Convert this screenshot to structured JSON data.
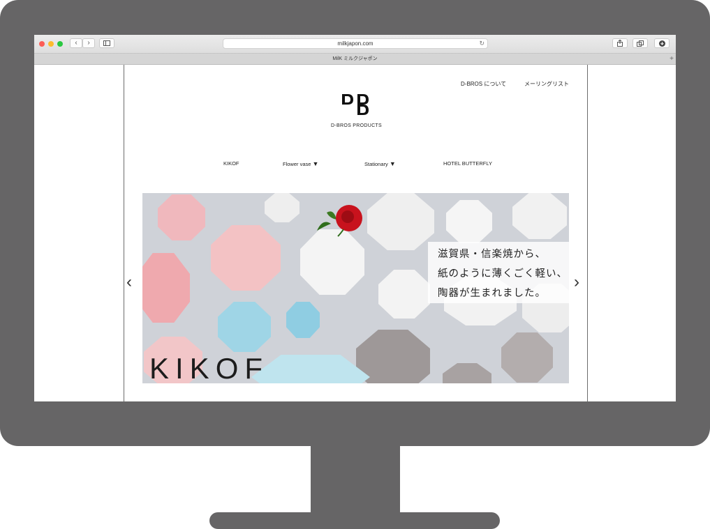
{
  "browser": {
    "url": "milkjapon.com",
    "tab_title": "MilK ミルクジャポン",
    "icons": [
      "chevron-left-icon",
      "chevron-right-icon",
      "sidebar-icon",
      "reload-icon",
      "share-icon",
      "tabs-icon",
      "download-icon",
      "plus-icon"
    ]
  },
  "site": {
    "top_links": {
      "about": "D-BROS について",
      "mailing": "メーリングリスト"
    },
    "logo_text": "DDD",
    "brand": "D-BROS PRODUCTS",
    "nav": {
      "kikof": "KIKOF",
      "flower": "Flower vase",
      "stationary": "Stationary",
      "hotel": "HOTEL BUTTERFLY",
      "dropdown_glyph": "▼"
    }
  },
  "hero": {
    "caption_lines": [
      "滋賀県・信楽焼から、",
      "紙のように薄くごく軽い、",
      "陶器が生まれました。"
    ],
    "overlay_word": "KIKOF",
    "prev_glyph": "‹",
    "next_glyph": "›"
  },
  "colors": {
    "monitor": "#666566",
    "hero_bg": "#cfd2d8",
    "pink": "#f0b8bd",
    "light_blue": "#9fd5e6",
    "white_dish": "#f2f2f2",
    "gray_dish": "#9e9898",
    "rose": "#c8121d"
  }
}
